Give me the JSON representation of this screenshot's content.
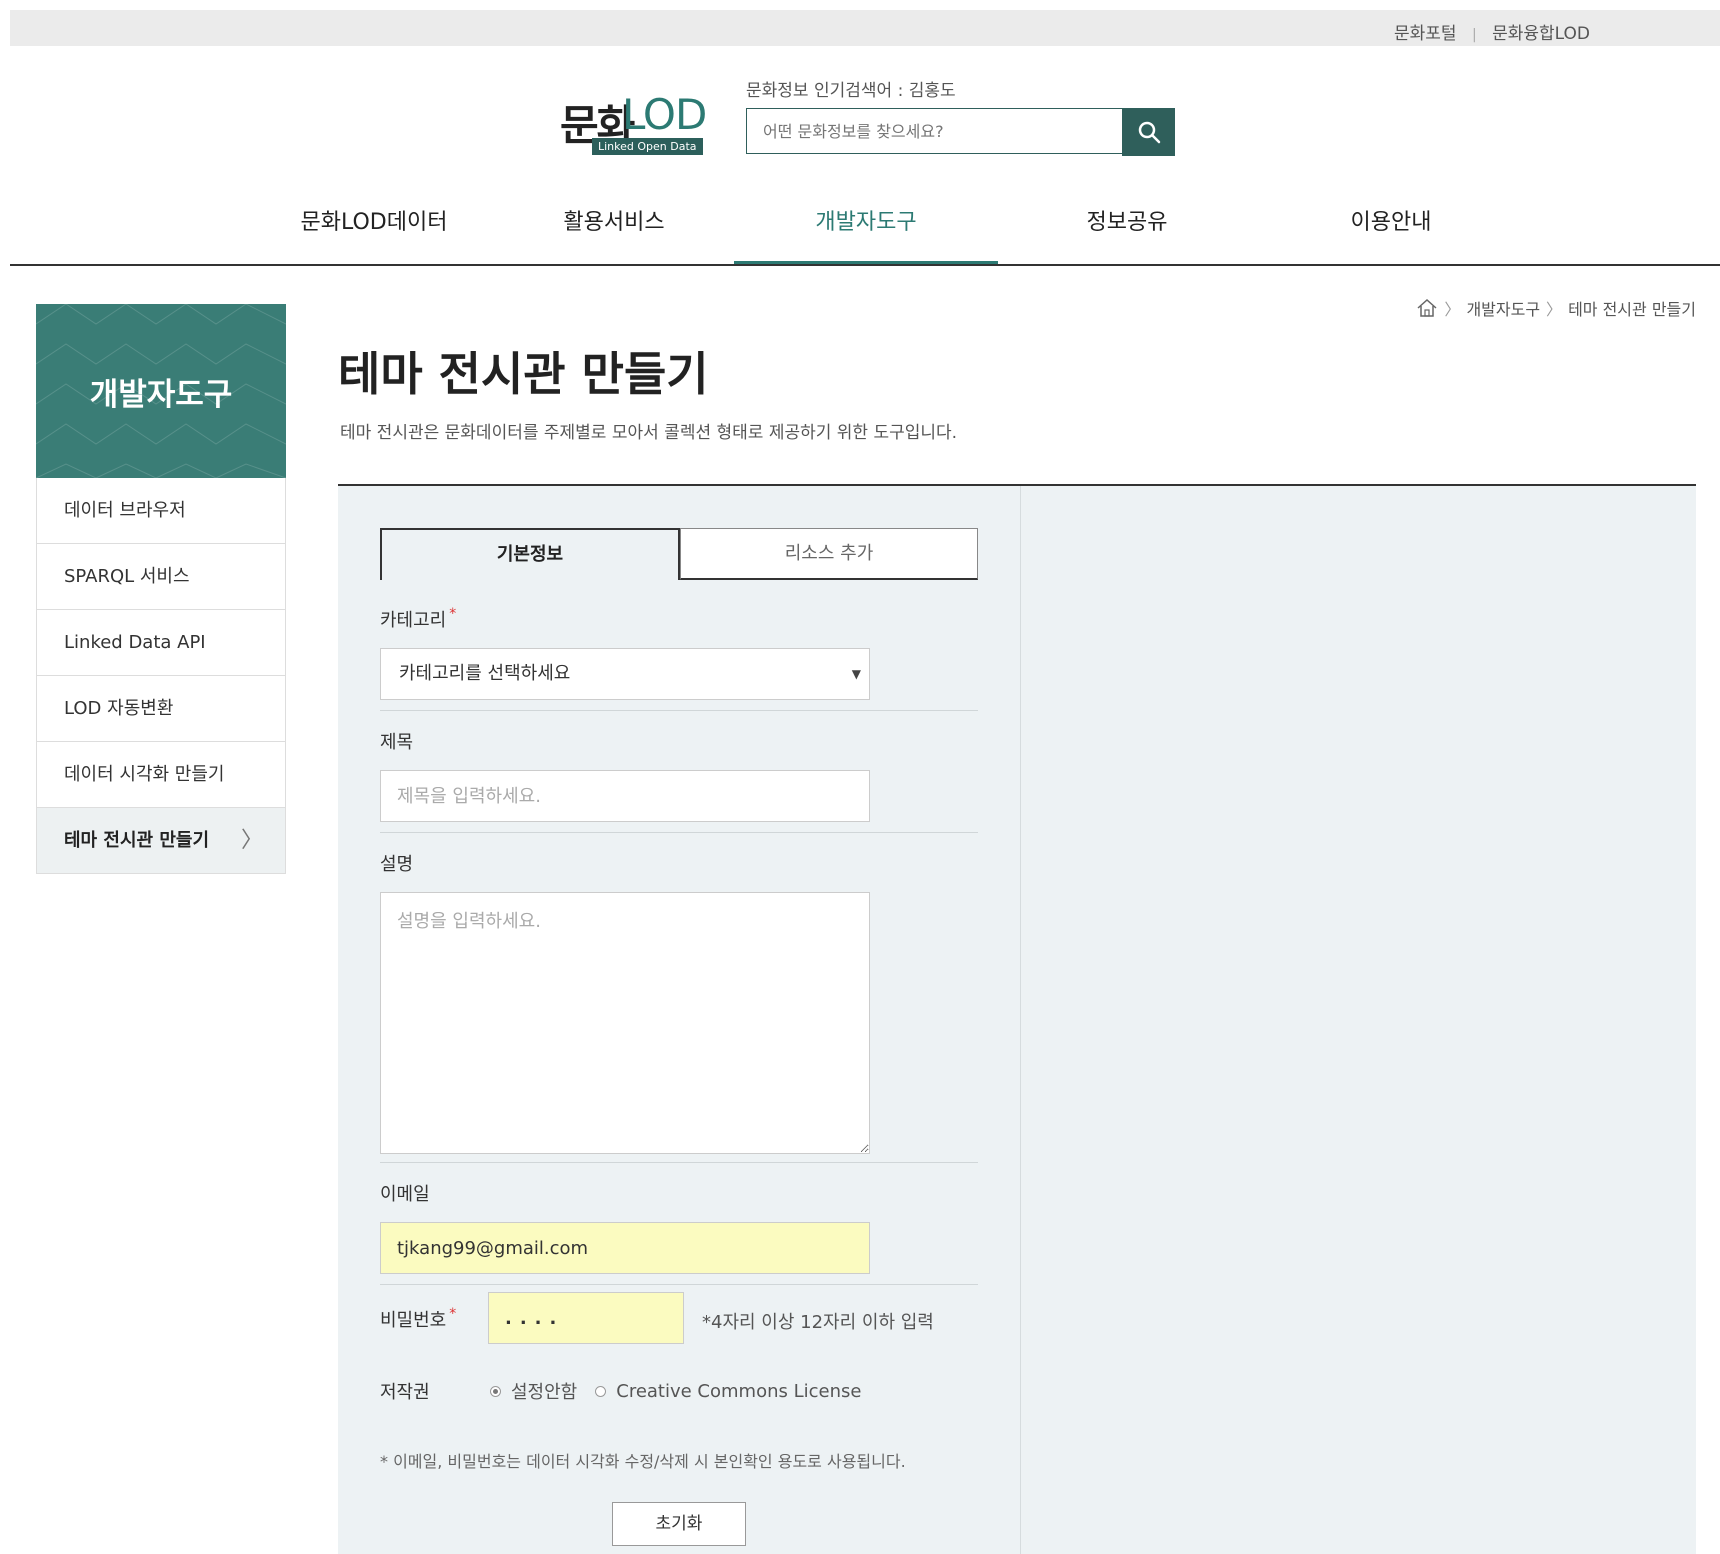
{
  "top_links": {
    "portal": "문화포털",
    "separator": "|",
    "lod": "문화융합LOD"
  },
  "logo": {
    "main": "문화",
    "lod": "LOD",
    "tagline": "Linked Open Data"
  },
  "search": {
    "popular": "문화정보 인기검색어 : 김홍도",
    "placeholder": "어떤 문화정보를 찾으세요?",
    "icon": "search-icon"
  },
  "nav": {
    "items": [
      "문화LOD데이터",
      "활용서비스",
      "개발자도구",
      "정보공유",
      "이용안내"
    ],
    "active": "개발자도구"
  },
  "sidebar": {
    "title": "개발자도구",
    "items": [
      "데이터 브라우저",
      "SPARQL 서비스",
      "Linked Data API",
      "LOD 자동변환",
      "데이터 시각화 만들기",
      "테마 전시관 만들기"
    ],
    "active_arrow": "〉"
  },
  "breadcrumb": {
    "home_icon": "home-icon",
    "items": [
      "개발자도구",
      "테마 전시관 만들기"
    ],
    "separator": "〉"
  },
  "page": {
    "title": "테마 전시관 만들기",
    "description": "테마 전시관은 문화데이터를 주제별로 모아서 콜렉션 형태로 제공하기 위한 도구입니다."
  },
  "form": {
    "tabs": [
      "기본정보",
      "리소스 추가"
    ],
    "category": {
      "label": "카테고리",
      "required": "*",
      "selected": "카테고리를 선택하세요"
    },
    "title": {
      "label": "제목",
      "placeholder": "제목을 입력하세요."
    },
    "description": {
      "label": "설명",
      "placeholder": "설명을 입력하세요."
    },
    "email": {
      "label": "이메일",
      "value": "tjkang99@gmail.com"
    },
    "password": {
      "label": "비밀번호",
      "required": "*",
      "value": "....",
      "hint": "*4자리 이상 12자리 이하 입력"
    },
    "copyright": {
      "label": "저작권",
      "options": [
        "설정안함",
        "Creative Commons License"
      ],
      "selected": "설정안함"
    },
    "notice": "* 이메일, 비밀번호는 데이터 시각화 수정/삭제 시 본인확인 용도로 사용됩니다.",
    "reset_label": "초기화"
  },
  "colors": {
    "accent": "#2c7a73",
    "sidebar_head": "#3a7d76",
    "panel_bg": "#edf2f4",
    "autofill": "#fbfbc0"
  }
}
